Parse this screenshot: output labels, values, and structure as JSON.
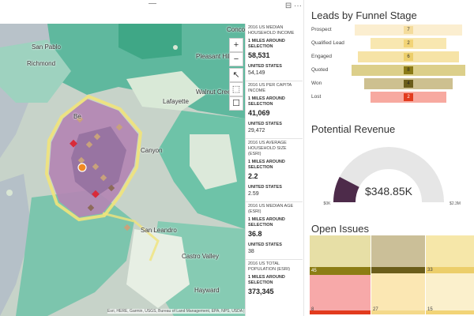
{
  "map": {
    "labels": {
      "san_pablo": "San Pablo",
      "richmond": "Richmond",
      "pleasant_hill": "Pleasant Hill",
      "concord": "Conco",
      "walnut_creek": "Walnut Creek",
      "lafayette": "Lafayette",
      "canyon": "Canyon",
      "san_leandro": "San Leandro",
      "castro_valley": "Castro Valley",
      "hayward": "Hayward",
      "berkeley": "Be"
    },
    "attribution": "Esri, HERE, Garmin, USGS, Bureau of Land Management, EPA, NPS, USDA | Esri, HERE, Ga",
    "logo_text": "esri",
    "controls": {
      "zoom_in": "+",
      "zoom_out": "−",
      "select": "↖",
      "lasso": "⬚",
      "more": "☐"
    }
  },
  "topbar": {
    "icons_text": "⊟  ···"
  },
  "info": [
    {
      "title": "2016 US MEDIAN HOUSEHOLD INCOME",
      "sub": "1 MILES AROUND SELECTION",
      "value": "58,531",
      "us_label": "UNITED STATES",
      "us_value": "54,149"
    },
    {
      "title": "2016 US PER CAPITA INCOME",
      "sub": "1 MILES AROUND SELECTION",
      "value": "41,069",
      "us_label": "UNITED STATES",
      "us_value": "29,472"
    },
    {
      "title": "2016 US AVERAGE HOUSEHOLD SIZE (ESRI)",
      "sub": "1 MILES AROUND SELECTION",
      "value": "2.2",
      "us_label": "UNITED STATES",
      "us_value": "2.59"
    },
    {
      "title": "2016 US MEDIAN AGE (ESRI)",
      "sub": "1 MILES AROUND SELECTION",
      "value": "36.8",
      "us_label": "UNITED STATES",
      "us_value": "38"
    },
    {
      "title": "2016 US TOTAL POPULATION (ESRI)",
      "sub": "1 MILES AROUND SELECTION",
      "value": "373,345",
      "us_label": "",
      "us_value": ""
    }
  ],
  "funnel": {
    "title": "Leads by Funnel Stage",
    "stages": [
      {
        "label": "Prospect",
        "value": 7,
        "color": "#fbeed0",
        "mid": "#f4dc9c"
      },
      {
        "label": "Qualified Lead",
        "value": 2,
        "color": "#f8e7b0",
        "mid": "#f2d477"
      },
      {
        "label": "Engaged",
        "value": 6,
        "color": "#f6e3a6",
        "mid": "#ecce6a"
      },
      {
        "label": "Quoted",
        "value": 8,
        "color": "#dccf8a",
        "mid": "#8a7a16"
      },
      {
        "label": "Won",
        "value": 4,
        "color": "#cdc090",
        "mid": "#6b5d1a"
      },
      {
        "label": "Lost",
        "value": 2,
        "color": "#f7a9a0",
        "mid": "#e23b1e"
      }
    ]
  },
  "revenue": {
    "title": "Potential Revenue",
    "value_text": "$348.85K",
    "min_label": "$0K",
    "max_label": "$2.3M",
    "fraction": 0.152,
    "fill_color": "#4d2b4a",
    "track_color": "#e6e6e6"
  },
  "issues": {
    "title": "Open Issues",
    "labels": {
      "a": "45",
      "b": "33",
      "c": "8",
      "d": "27",
      "e": "15"
    }
  }
}
